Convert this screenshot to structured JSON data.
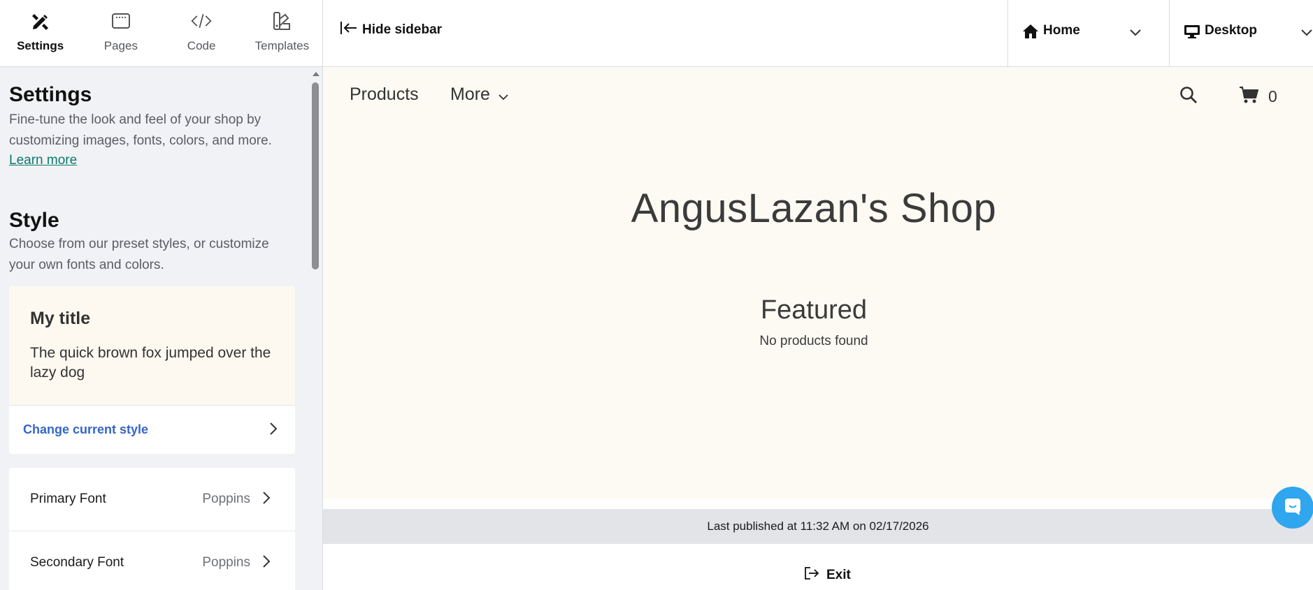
{
  "top_nav": {
    "items": [
      {
        "label": "Settings",
        "icon": "settings-icon",
        "active": true
      },
      {
        "label": "Pages",
        "icon": "pages-icon",
        "active": false
      },
      {
        "label": "Code",
        "icon": "code-icon",
        "active": false
      },
      {
        "label": "Templates",
        "icon": "templates-icon",
        "active": false
      }
    ]
  },
  "settings": {
    "title": "Settings",
    "description": "Fine-tune the look and feel of your shop by customizing images, fonts, colors, and more.",
    "learn_more": "Learn more"
  },
  "style": {
    "title": "Style",
    "description": "Choose from our preset styles, or customize your own fonts and colors.",
    "preview_title": "My title",
    "preview_text": "The quick brown fox jumped over the lazy dog",
    "change_style": "Change current style"
  },
  "fonts": [
    {
      "label": "Primary Font",
      "value": "Poppins"
    },
    {
      "label": "Secondary Font",
      "value": "Poppins"
    }
  ],
  "toolbar": {
    "hide_sidebar": "Hide sidebar",
    "page_select": "Home",
    "device_select": "Desktop"
  },
  "shop": {
    "nav": [
      "Products",
      "More"
    ],
    "title": "AngusLazan's Shop",
    "featured": "Featured",
    "no_products": "No products found",
    "cart_count": "0"
  },
  "status": {
    "last_published": "Last published at 11:32 AM on 02/17/2026",
    "exit": "Exit"
  },
  "colors": {
    "accent_link": "#0b7a6a",
    "change_style_link": "#3566c7",
    "preview_bg": "#fdfaf3",
    "chat_bubble": "#2fa6ee"
  }
}
